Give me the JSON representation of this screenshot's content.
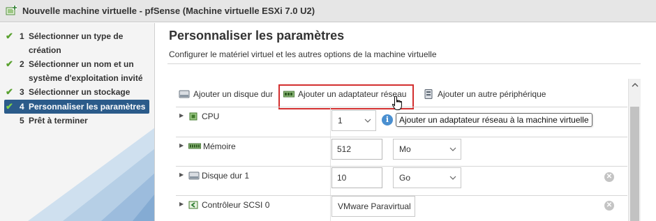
{
  "window": {
    "title": "Nouvelle machine virtuelle - pfSense (Machine virtuelle ESXi 7.0 U2)",
    "icon": "new-vm-icon"
  },
  "sidebar": {
    "steps": [
      {
        "num": "1",
        "label": "Sélectionner un type de création",
        "done": true
      },
      {
        "num": "2",
        "label": "Sélectionner un nom et un système d'exploitation invité",
        "done": true
      },
      {
        "num": "3",
        "label": "Sélectionner un stockage",
        "done": true
      },
      {
        "num": "4",
        "label": "Personnaliser les paramètres",
        "done": true,
        "active": true
      },
      {
        "num": "5",
        "label": "Prêt à terminer",
        "done": false
      }
    ]
  },
  "main": {
    "title": "Personnaliser les paramètres",
    "subtitle": "Configurer le matériel virtuel et les autres options de la machine virtuelle"
  },
  "toolbar": {
    "add_disk": "Ajouter un disque dur",
    "add_network": "Ajouter un adaptateur réseau",
    "add_other": "Ajouter un autre périphérique"
  },
  "tooltip": "Ajouter un adaptateur réseau à la machine virtuelle",
  "hardware": {
    "cpu": {
      "label": "CPU",
      "value": "1"
    },
    "memory": {
      "label": "Mémoire",
      "value": "512",
      "unit": "Mo"
    },
    "disk": {
      "label": "Disque dur 1",
      "value": "10",
      "unit": "Go"
    },
    "scsi": {
      "label": "Contrôleur SCSI 0",
      "value": "VMware Paravirtual"
    }
  },
  "colors": {
    "accent_active": "#2b5b8a",
    "check": "#5aa130",
    "highlight": "#d32f2f",
    "info": "#4a8fd0"
  }
}
